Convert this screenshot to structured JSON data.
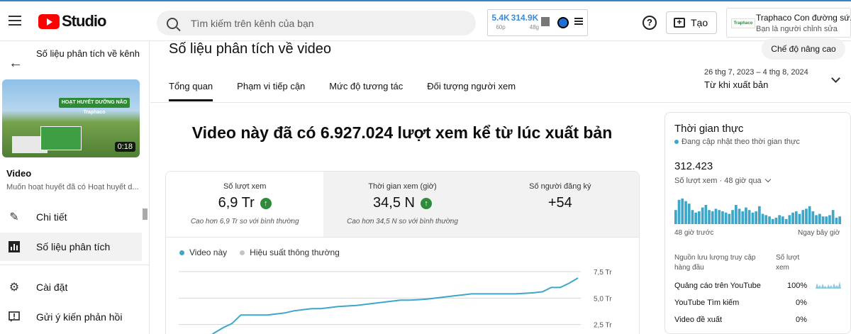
{
  "header": {
    "logo_text": "Studio",
    "search_placeholder": "Tìm kiếm trên kênh của bạn",
    "stats": [
      {
        "value": "5.4K",
        "label": "60p"
      },
      {
        "value": "314.9K",
        "label": "48g"
      }
    ],
    "help_symbol": "?",
    "create_label": "Tạo",
    "channel_logo_text": "Traphaco",
    "channel_name": "Traphaco Con đường sứ...",
    "channel_role": "Bạn là người chỉnh sửa"
  },
  "sidebar": {
    "back_title": "Số liệu phân tích về kênh",
    "thumb_banner": "HOẠT HUYẾT DƯỠNG NÃO Traphaco",
    "thumb_duration": "0:18",
    "video_label": "Video",
    "video_title": "Muốn hoạt huyết đã có Hoạt huyết d...",
    "items": [
      {
        "label": "Chi tiết",
        "icon": "pencil-icon"
      },
      {
        "label": "Số liệu phân tích",
        "icon": "analytics-icon"
      },
      {
        "label": "Cài đặt",
        "icon": "gear-icon"
      },
      {
        "label": "Gửi ý kiến phản hồi",
        "icon": "feedback-icon"
      }
    ]
  },
  "main": {
    "page_title": "Số liệu phân tích về video",
    "advanced_mode": "Chế độ nâng cao",
    "tabs": [
      "Tổng quan",
      "Phạm vi tiếp cận",
      "Mức độ tương tác",
      "Đối tượng người xem"
    ],
    "date_range": "26 thg 7, 2023 – 4 thg 8, 2024",
    "date_label": "Từ khi xuất bản",
    "headline": "Video này đã có 6.927.024 lượt xem kể từ lúc xuất bản",
    "metrics": [
      {
        "label": "Số lượt xem",
        "value": "6,9 Tr",
        "note": "Cao hơn 6,9 Tr so với bình thường",
        "up": true
      },
      {
        "label": "Thời gian xem (giờ)",
        "value": "34,5 N",
        "note": "Cao hơn 34,5 N so với bình thường",
        "up": true
      },
      {
        "label": "Số người đăng ký",
        "value": "+54",
        "note": "",
        "up": false
      }
    ],
    "legend": [
      {
        "label": "Video này",
        "color": "#3ea6c9"
      },
      {
        "label": "Hiệu suất thông thường",
        "color": "#c4c4c4"
      }
    ]
  },
  "chart_data": {
    "type": "line",
    "series": [
      {
        "name": "Video này",
        "values": [
          0.05,
          0.3,
          0.6,
          1.1,
          1.7,
          2.2,
          2.6,
          3.4,
          3.4,
          3.4,
          3.4,
          3.5,
          3.6,
          3.8,
          3.9,
          4.0,
          4.0,
          4.1,
          4.2,
          4.25,
          4.3,
          4.4,
          4.5,
          4.6,
          4.7,
          4.8,
          4.8,
          4.85,
          4.9,
          5.0,
          5.1,
          5.2,
          5.3,
          5.4,
          5.4,
          5.4,
          5.4,
          5.4,
          5.4,
          5.45,
          5.5,
          5.6,
          6.0,
          6.0,
          6.4,
          6.9
        ]
      }
    ],
    "yticks": [
      "7,5 Tr",
      "5,0 Tr",
      "2,5 Tr"
    ],
    "ytick_values": [
      7.5,
      5.0,
      2.5
    ],
    "ylim": [
      0,
      7.5
    ],
    "grid": true
  },
  "realtime": {
    "title": "Thời gian thực",
    "subtitle": "Đang cập nhật theo thời gian thực",
    "value": "312.423",
    "value_label": "Số lượt xem · 48 giờ qua",
    "axis_left": "48 giờ trước",
    "axis_right": "Ngay bây giờ",
    "bars": [
      0.55,
      0.95,
      1.0,
      0.9,
      0.8,
      0.55,
      0.45,
      0.5,
      0.65,
      0.75,
      0.55,
      0.5,
      0.6,
      0.55,
      0.5,
      0.45,
      0.4,
      0.55,
      0.75,
      0.6,
      0.5,
      0.65,
      0.55,
      0.45,
      0.5,
      0.7,
      0.4,
      0.35,
      0.3,
      0.2,
      0.25,
      0.35,
      0.3,
      0.2,
      0.35,
      0.45,
      0.5,
      0.4,
      0.55,
      0.6,
      0.7,
      0.5,
      0.35,
      0.4,
      0.3,
      0.3,
      0.35,
      0.55,
      0.25,
      0.3
    ],
    "source_header": "Nguồn lưu lượng truy cập hàng đầu",
    "views_header": "Số lượt xem",
    "sources": [
      {
        "name": "Quảng cáo trên YouTube",
        "pct": "100%"
      },
      {
        "name": "YouTube Tìm kiếm",
        "pct": "0%"
      },
      {
        "name": "Video đề xuất",
        "pct": "0%"
      }
    ]
  }
}
